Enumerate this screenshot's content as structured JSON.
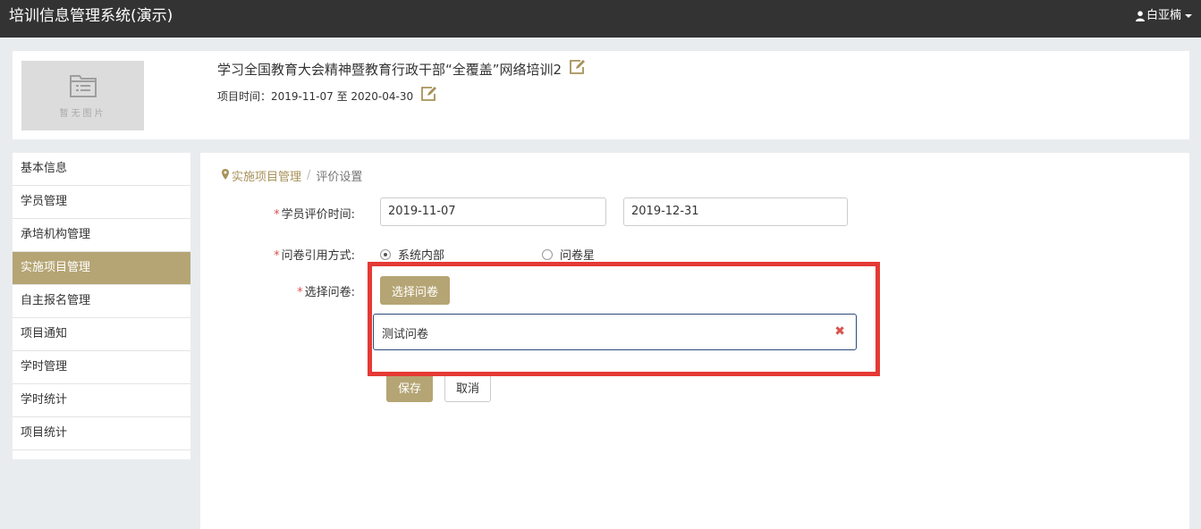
{
  "app": {
    "title": "培训信息管理系统(演示)",
    "user_name": "白亚楠"
  },
  "project": {
    "thumbnail_text": "暂无图片",
    "title": "学习全国教育大会精神暨教育行政干部“全覆盖”网络培训2",
    "time_label": "项目时间：",
    "time_value": "2019-11-07 至 2020-04-30"
  },
  "sidebar": {
    "items": [
      {
        "label": "基本信息"
      },
      {
        "label": "学员管理"
      },
      {
        "label": "承培机构管理"
      },
      {
        "label": "实施项目管理",
        "active": true
      },
      {
        "label": "自主报名管理"
      },
      {
        "label": "项目通知"
      },
      {
        "label": "学时管理"
      },
      {
        "label": "学时统计"
      },
      {
        "label": "项目统计"
      }
    ]
  },
  "breadcrumb": {
    "parent": "实施项目管理",
    "current": "评价设置"
  },
  "form": {
    "eval_time_label": "学员评价时间:",
    "start_date": "2019-11-07",
    "end_date": "2019-12-31",
    "quote_method_label": "问卷引用方式:",
    "option_internal": "系统内部",
    "option_wjx": "问卷星",
    "select_label": "选择问卷:",
    "select_button": "选择问卷",
    "selected_questionnaire": "测试问卷",
    "remove_symbol": "✖",
    "save_button": "保存",
    "cancel_button": "取消"
  },
  "colors": {
    "accent": "#b5a574",
    "navbar": "#333333",
    "highlight": "#e53935"
  }
}
